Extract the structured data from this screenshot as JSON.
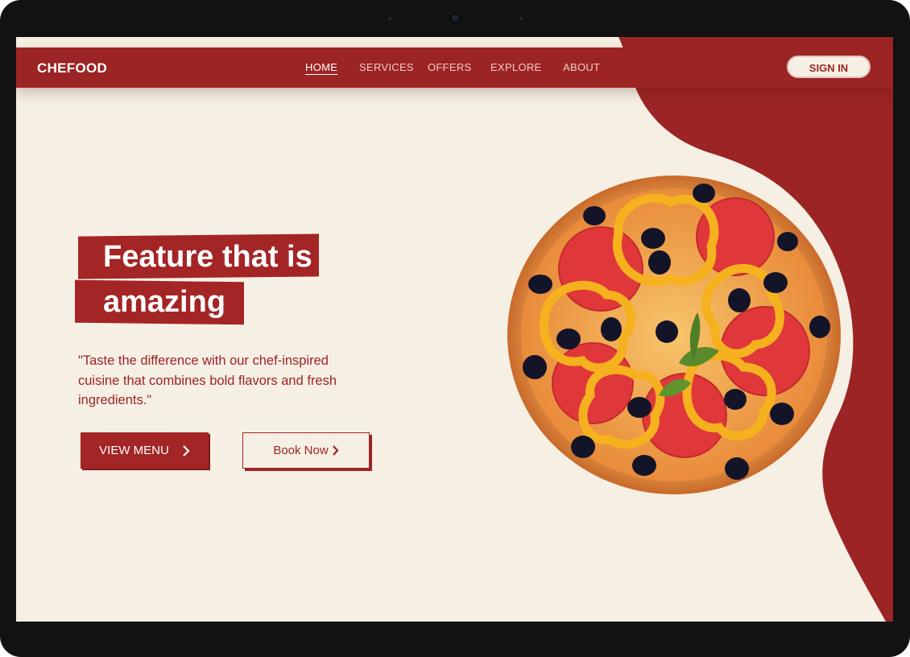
{
  "brand": {
    "name": "CHEFOOD"
  },
  "nav": {
    "links": [
      {
        "label": "HOME",
        "active": true
      },
      {
        "label": "SERVICES",
        "active": false
      },
      {
        "label": "OFFERS",
        "active": false
      },
      {
        "label": "EXPLORE",
        "active": false
      },
      {
        "label": "ABOUT",
        "active": false
      }
    ],
    "signin_label": "SIGN IN"
  },
  "hero": {
    "title_line1": "Feature that is",
    "title_line2": "amazing",
    "description": "\"Taste the difference with our chef-inspired cuisine that combines bold flavors and fresh ingredients.\"",
    "primary_button": "VIEW MENU",
    "secondary_button": "Book Now"
  },
  "icons": {
    "primary_button_icon": "chevron-right-icon",
    "secondary_button_icon": "chevron-right-icon",
    "hero_image": "pizza-image"
  },
  "colors": {
    "accent": "#9c2424",
    "background": "#f6efe4",
    "light_text": "#f0c9c4"
  }
}
